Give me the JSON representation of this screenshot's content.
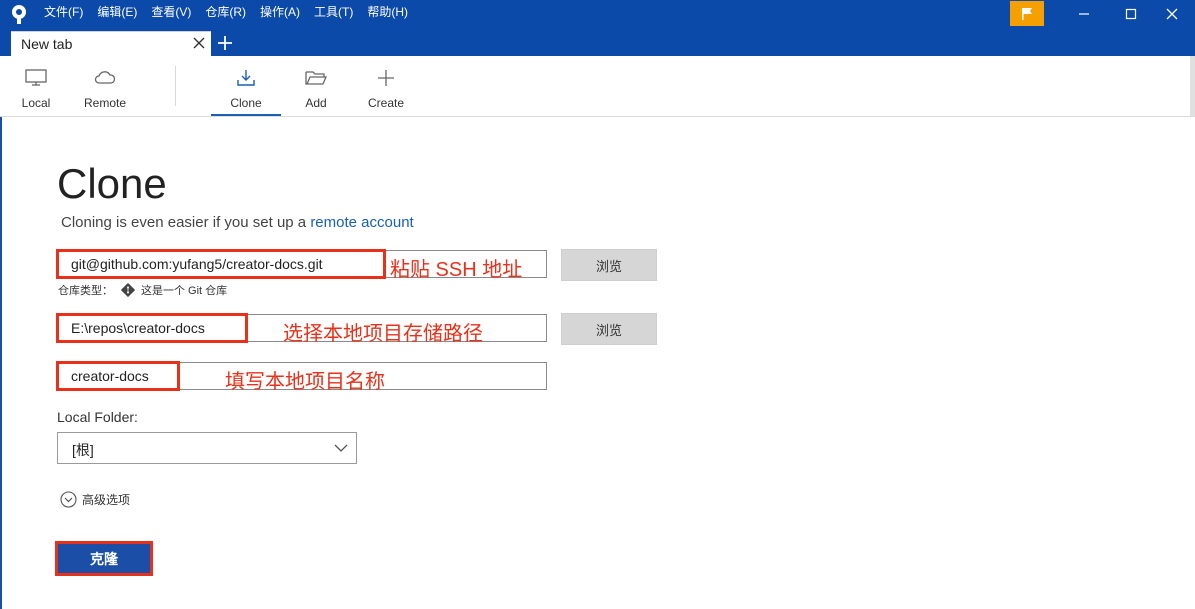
{
  "menu": [
    "文件(F)",
    "编辑(E)",
    "查看(V)",
    "仓库(R)",
    "操作(A)",
    "工具(T)",
    "帮助(H)"
  ],
  "tab": {
    "label": "New tab"
  },
  "toolbar": {
    "local": "Local",
    "remote": "Remote",
    "clone": "Clone",
    "add": "Add",
    "create": "Create"
  },
  "page": {
    "title": "Clone",
    "subtitle_prefix": "Cloning is even easier if you set up a ",
    "subtitle_link": "remote account"
  },
  "source": {
    "value": "git@github.com:yufang5/creator-docs.git",
    "annotation": "粘贴 SSH 地址",
    "browse_label": "浏览"
  },
  "repo_type": {
    "label": "仓库类型：",
    "value": "这是一个 Git 仓库"
  },
  "destination": {
    "value": "E:\\repos\\creator-docs",
    "annotation": "选择本地项目存储路径",
    "browse_label": "浏览"
  },
  "name": {
    "value": "creator-docs",
    "annotation": "填写本地项目名称"
  },
  "local_folder": {
    "label": "Local Folder:",
    "selected": "[根]"
  },
  "advanced": {
    "label": "高级选项"
  },
  "clone_button": {
    "label": "克隆"
  },
  "colors": {
    "titlebar": "#0b4aa9",
    "annotation_red": "#e8311a",
    "accent_blue": "#1b4fa7",
    "flag": "#f5a000"
  }
}
